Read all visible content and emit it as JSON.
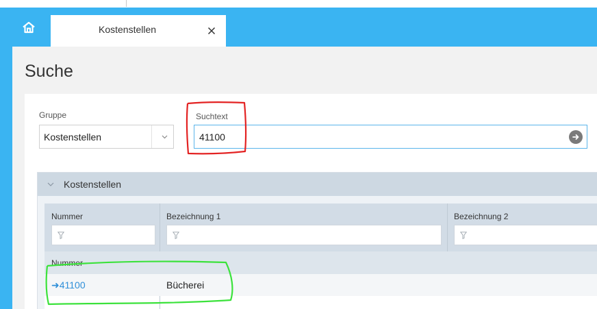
{
  "tabs": [
    {
      "label": "Kostenstellen",
      "close_icon": "close-icon"
    }
  ],
  "home": {
    "icon": "home-icon"
  },
  "page": {
    "title": "Suche"
  },
  "search": {
    "group_label": "Gruppe",
    "group_value": "Kostenstellen",
    "text_label": "Suchtext",
    "text_value": "41100",
    "go_icon": "arrow-right-circle-icon"
  },
  "results": {
    "group_title": "Kostenstellen",
    "columns": [
      "Nummer",
      "Bezeichnung 1",
      "Bezeichnung 2"
    ],
    "subheader": "Nummer",
    "rows": [
      {
        "nummer": "41100",
        "bezeichnung1": "Bücherei",
        "bezeichnung2": ""
      }
    ]
  },
  "colors": {
    "header": "#3ab4f2",
    "link": "#2f8fd8",
    "annotation_red": "#e32222",
    "annotation_green": "#3be23b"
  }
}
